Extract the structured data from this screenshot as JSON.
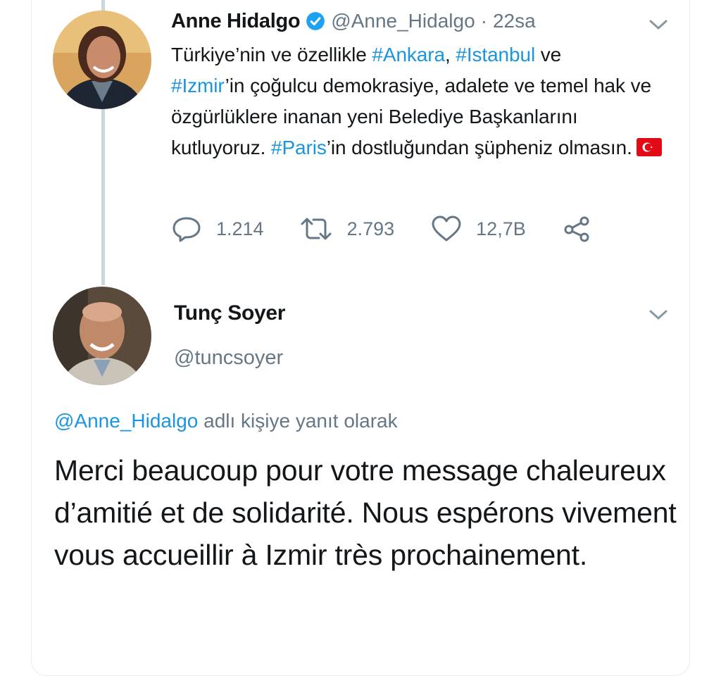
{
  "colors": {
    "link": "#1b95e0",
    "muted": "#657786",
    "text": "#14171a",
    "verified": "#1da1f2",
    "border": "#e6ecf0"
  },
  "tweet1": {
    "author_name": "Anne Hidalgo",
    "verified_icon": "verified-badge-icon",
    "handle": "@Anne_Hidalgo",
    "separator": "·",
    "time": "22sa",
    "text": {
      "p1": "Türkiye’nin ve özellikle ",
      "h1": "#Ankara",
      "p2": ", ",
      "h2": "#Istanbul",
      "p3": " ve ",
      "h3": "#Izmir",
      "p4": "’in çoğulcu demokrasiye, adalete ve temel hak ve özgürlüklere inanan yeni Belediye Başkanlarını kutluyoruz. ",
      "h4": "#Paris",
      "p5": "’in dostluğundan şüpheniz olmasın."
    },
    "flag_icon": "turkey-flag-emoji",
    "actions": {
      "reply_count": "1.214",
      "retweet_count": "2.793",
      "like_count": "12,7B"
    }
  },
  "tweet2": {
    "author_name": "Tunç Soyer",
    "handle": "@tuncsoyer",
    "reply_to_mention": "@Anne_Hidalgo",
    "reply_to_suffix": " adlı kişiye yanıt olarak",
    "text": "Merci beaucoup pour votre message chaleureux d’amitié et de solidarité. Nous espérons vivement vous accueillir à Izmir très prochainement."
  }
}
